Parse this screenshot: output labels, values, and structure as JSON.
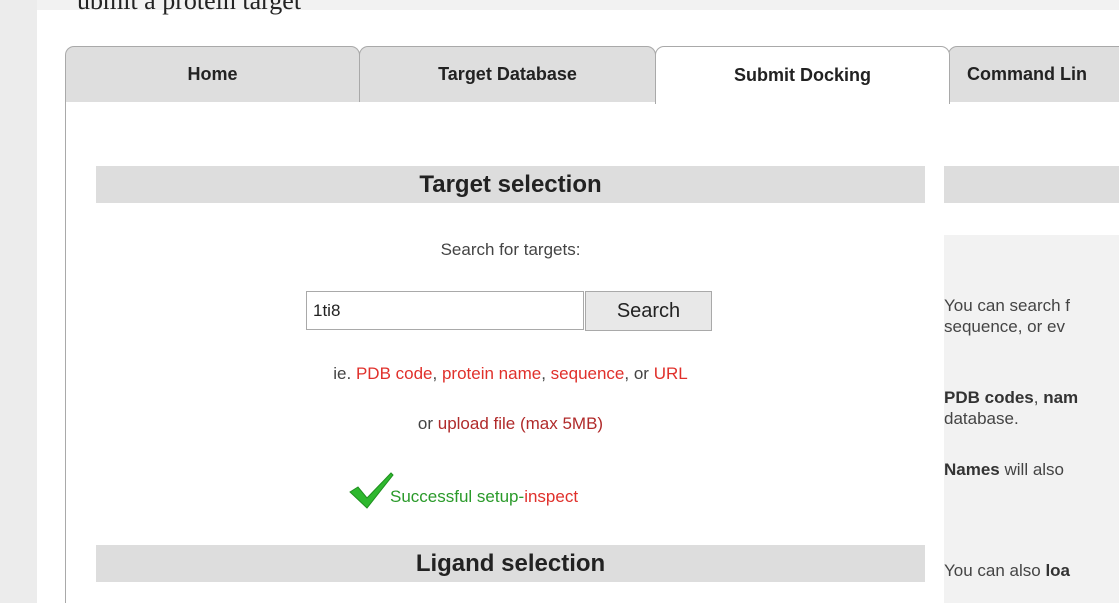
{
  "page_top_text": "ubmit a protein target",
  "tabs": [
    {
      "label": "Home"
    },
    {
      "label": "Target Database"
    },
    {
      "label": "Submit Docking"
    },
    {
      "label": "Command Lin"
    }
  ],
  "target_section": {
    "title": "Target selection",
    "search_label": "Search for targets:",
    "search_value": "1ti8",
    "search_button": "Search",
    "hint_prefix": "ie. ",
    "hint_pdb": "PDB code",
    "hint_sep1": ", ",
    "hint_protein": "protein name",
    "hint_sep2": ", ",
    "hint_sequence": "sequence",
    "hint_sep3": ", or ",
    "hint_url": "URL",
    "upload_prefix": "or ",
    "upload_link": "upload file",
    "upload_suffix": " (max 5MB)",
    "success_text": "Successful setup",
    "success_sep": " - ",
    "inspect_link": "inspect"
  },
  "ligand_section": {
    "title": "Ligand selection"
  },
  "right_panel": {
    "line1a": "You can search f",
    "line1b": "sequence, or ev",
    "line2_bold1": "PDB codes",
    "line2_sep": ", ",
    "line2_bold2": "nam",
    "line2b": "database.",
    "line3_bold": "Names",
    "line3_rest": " will also",
    "line4_text": "You can also ",
    "line4_bold": "loa"
  },
  "colors": {
    "link_red": "#e0302b",
    "success_green": "#2a9a2a",
    "section_bar": "#dddddd"
  }
}
